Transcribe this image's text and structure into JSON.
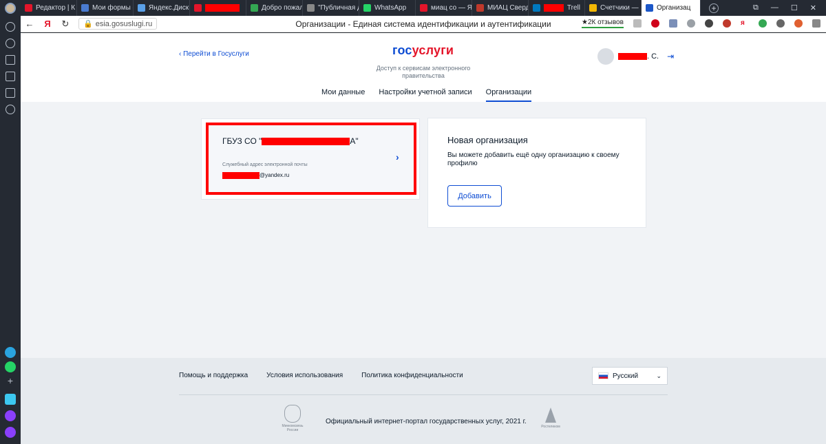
{
  "browser": {
    "tabs": [
      {
        "label": "Редактор | К",
        "icon_color": "#e4152a"
      },
      {
        "label": "Мои формы с",
        "icon_color": "#4a7bd0"
      },
      {
        "label": "Яндекс.Диск",
        "icon_color": "#5aa0e8"
      },
      {
        "label": "",
        "icon_color": "#e4152a",
        "redacted": true
      },
      {
        "label": "Добро пожал",
        "icon_color": "#34a853"
      },
      {
        "label": "\"Публичная д",
        "icon_color": "#888888"
      },
      {
        "label": "WhatsApp",
        "icon_color": "#25d366"
      },
      {
        "label": "миац со — Я",
        "icon_color": "#e4152a"
      },
      {
        "label": "МИАЦ Сверд",
        "icon_color": "#c0392b"
      },
      {
        "label": "Trell",
        "icon_color": "#0079bf",
        "redacted": true
      },
      {
        "label": "Счетчики — Я",
        "icon_color": "#f2b705"
      },
      {
        "label": "Организац",
        "icon_color": "#1c57c8",
        "active": true
      }
    ],
    "new_tab": "+",
    "address": {
      "url": "esia.gosuslugi.ru",
      "page_title": "Организации - Единая система идентификации и аутентификации",
      "reviews": "★2К отзывов"
    }
  },
  "site": {
    "back_link": "Перейти в Госуслуги",
    "logo_part1": "гос",
    "logo_part2": "услуги",
    "logo_sub": "Доступ к сервисам электронного правительства",
    "user_name_suffix": ". С.",
    "nav": [
      "Мои данные",
      "Настройки учетной записи",
      "Организации"
    ],
    "nav_active": "Организации"
  },
  "org_card": {
    "title_prefix": "ГБУЗ СО \"",
    "title_suffix": "А\"",
    "email_label": "Служебный адрес электронной почты",
    "email_suffix": "@yandex.ru"
  },
  "new_org": {
    "title": "Новая организация",
    "description": "Вы можете добавить ещё одну организацию к своему профилю",
    "add_button": "Добавить"
  },
  "footer": {
    "links": [
      "Помощь и поддержка",
      "Условия использования",
      "Политика конфиденциальности"
    ],
    "language": "Русский",
    "emblem_caption": "Минкомсвязь России",
    "official_text": "Официальный интернет-портал государственных услуг, 2021 г.",
    "rtk_caption": "Ростелеком"
  },
  "colors": {
    "brand_blue": "#0d4cd3",
    "brand_red": "#e4152a",
    "highlight_red": "#ff0000"
  }
}
